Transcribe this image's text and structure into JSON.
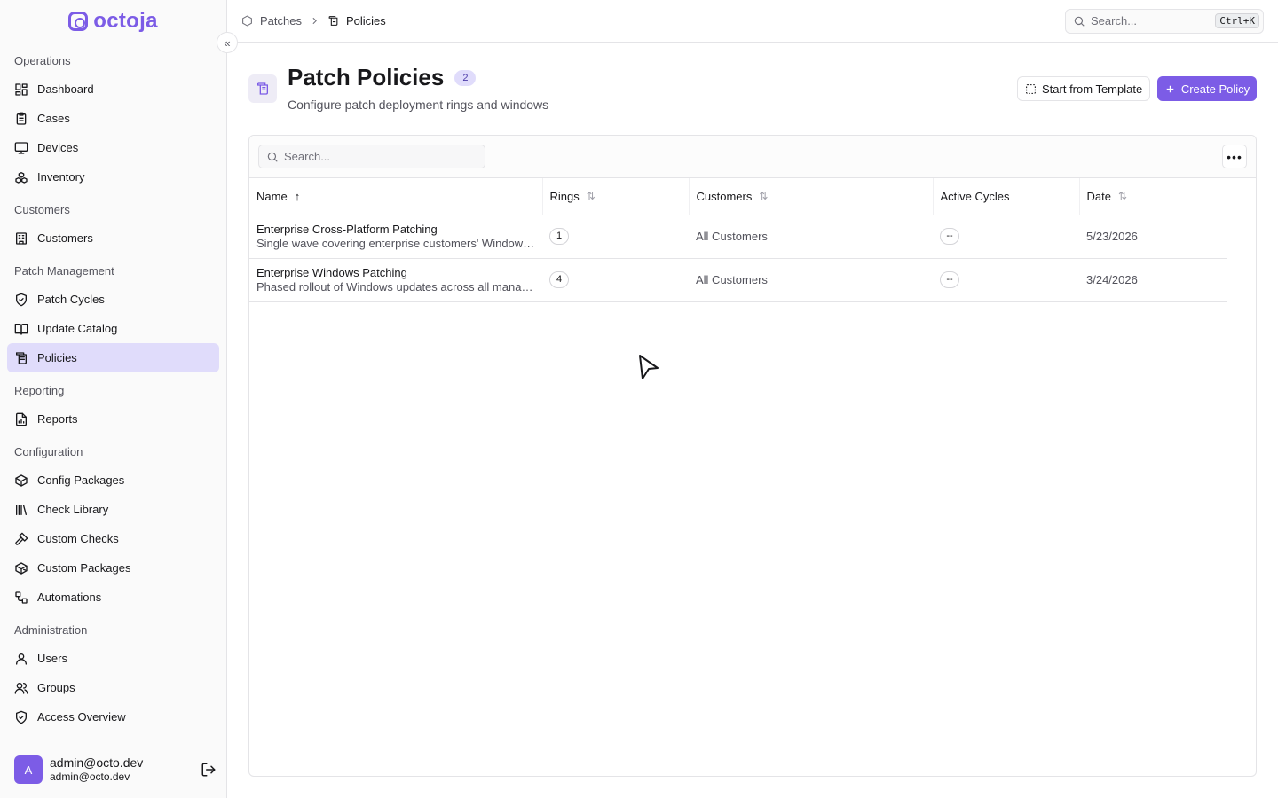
{
  "brand": {
    "name": "octoja",
    "accent": "#7c5ce6"
  },
  "sidebar": {
    "groups": [
      {
        "label": "Operations",
        "items": [
          {
            "label": "Dashboard",
            "icon": "dashboard-icon"
          },
          {
            "label": "Cases",
            "icon": "clipboard-icon"
          },
          {
            "label": "Devices",
            "icon": "monitor-icon"
          },
          {
            "label": "Inventory",
            "icon": "boxes-icon"
          }
        ]
      },
      {
        "label": "Customers",
        "items": [
          {
            "label": "Customers",
            "icon": "building-icon"
          }
        ]
      },
      {
        "label": "Patch Management",
        "items": [
          {
            "label": "Patch Cycles",
            "icon": "shield-check-icon"
          },
          {
            "label": "Update Catalog",
            "icon": "book-open-icon"
          },
          {
            "label": "Policies",
            "icon": "scroll-icon",
            "active": true
          }
        ]
      },
      {
        "label": "Reporting",
        "items": [
          {
            "label": "Reports",
            "icon": "report-icon"
          }
        ]
      },
      {
        "label": "Configuration",
        "items": [
          {
            "label": "Config Packages",
            "icon": "package-icon"
          },
          {
            "label": "Check Library",
            "icon": "library-icon"
          },
          {
            "label": "Custom Checks",
            "icon": "hammer-icon"
          },
          {
            "label": "Custom Packages",
            "icon": "package-plus-icon"
          },
          {
            "label": "Automations",
            "icon": "workflow-icon"
          }
        ]
      },
      {
        "label": "Administration",
        "items": [
          {
            "label": "Users",
            "icon": "user-icon"
          },
          {
            "label": "Groups",
            "icon": "users-icon"
          },
          {
            "label": "Access Overview",
            "icon": "shield-icon"
          }
        ]
      }
    ],
    "user": {
      "initial": "A",
      "name": "admin@octo.dev",
      "email": "admin@octo.dev"
    }
  },
  "topbar": {
    "breadcrumb": [
      "Patches",
      "Policies"
    ],
    "search_placeholder": "Search...",
    "shortcut": "Ctrl+K"
  },
  "header": {
    "title": "Patch Policies",
    "count": "2",
    "subtitle": "Configure patch deployment rings and windows",
    "template_button": "Start from Template",
    "create_button": "Create Policy"
  },
  "table": {
    "search_placeholder": "Search...",
    "columns": [
      "Name",
      "Rings",
      "Customers",
      "Active Cycles",
      "Date"
    ],
    "rows": [
      {
        "name": "Enterprise Cross-Platform Patching",
        "description": "Single wave covering enterprise customers' Windows, macOS and Linux devices",
        "rings": "1",
        "customers": "All Customers",
        "active_cycles": "--",
        "date": "5/23/2026"
      },
      {
        "name": "Enterprise Windows Patching",
        "description": "Phased rollout of Windows updates across all managed devices",
        "rings": "4",
        "customers": "All Customers",
        "active_cycles": "--",
        "date": "3/24/2026"
      }
    ]
  }
}
